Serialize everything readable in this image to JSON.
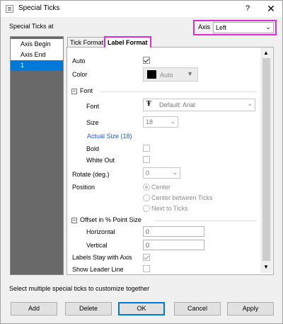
{
  "window": {
    "title": "Special Ticks",
    "help": "?",
    "close": "✕"
  },
  "section_label": "Special Ticks at",
  "axis": {
    "label": "Axis",
    "value": "Left"
  },
  "ticks_list": [
    "Axis Begin",
    "Axis End",
    "1"
  ],
  "tabs": [
    "Tick Format",
    "Label Format"
  ],
  "form": {
    "auto_label": "Auto",
    "auto_checked": true,
    "color_label": "Color",
    "color_value": "Auto",
    "color_swatch": "#000000",
    "font_group": "Font",
    "font_label": "Font",
    "font_value": "Default: Arial",
    "size_label": "Size",
    "size_value": "18",
    "actual_size": "Actual Size (18)",
    "bold_label": "Bold",
    "whiteout_label": "White Out",
    "rotate_label": "Rotate (deg.)",
    "rotate_value": "0",
    "position_label": "Position",
    "position_options": [
      "Center",
      "Center between Ticks",
      "Next to Ticks"
    ],
    "position_selected": "Center",
    "offset_group": "Offset in % Point Size",
    "horizontal_label": "Horizontal",
    "horizontal_value": "0",
    "vertical_label": "Vertical",
    "vertical_value": "0",
    "stay_label": "Labels Stay with Axis",
    "stay_checked": true,
    "leader_label": "Show Leader Line"
  },
  "hint": "Select multiple special ticks to customize together",
  "buttons": [
    "Add",
    "Delete",
    "OK",
    "Cancel",
    "Apply"
  ],
  "colors": {
    "highlight": "#e02bd6",
    "selection": "#0078d7",
    "link": "#1a5fd1"
  }
}
